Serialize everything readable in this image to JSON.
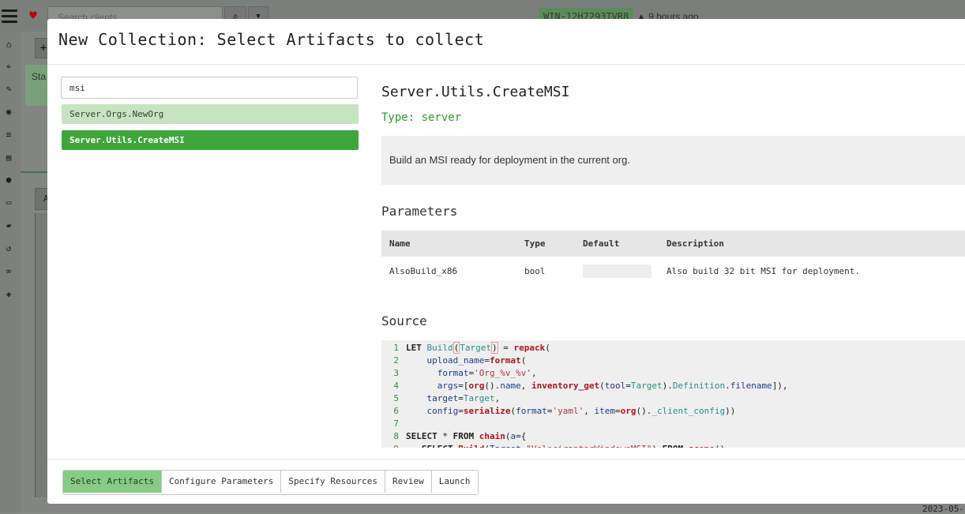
{
  "background": {
    "search_placeholder": "Search clients",
    "host_badge": "WIN-12H7293TVR8",
    "host_age": "9 hours ago",
    "plus_label": "+",
    "status_label": "Sta",
    "tab_label": "A",
    "date_fragment": "2023-05-"
  },
  "modal": {
    "title": "New Collection: Select Artifacts to collect",
    "search_value": "msi",
    "artifacts": [
      {
        "name": "Server.Orgs.NewOrg"
      },
      {
        "name": "Server.Utils.CreateMSI"
      }
    ],
    "detail": {
      "name": "Server.Utils.CreateMSI",
      "type": "Type: server",
      "description": "Build an MSI ready for deployment in the current org.",
      "parameters_heading": "Parameters",
      "columns": [
        "Name",
        "Type",
        "Default",
        "Description"
      ],
      "param": {
        "name": "AlsoBuild_x86",
        "type": "bool",
        "default": "",
        "description": "Also build 32 bit MSI for deployment."
      },
      "source_heading": "Source",
      "line_numbers": [
        "1",
        "2",
        "3",
        "4",
        "5",
        "6",
        "7",
        "8",
        "9"
      ]
    },
    "steps": [
      "Select Artifacts",
      "Configure Parameters",
      "Specify Resources",
      "Review",
      "Launch"
    ]
  }
}
